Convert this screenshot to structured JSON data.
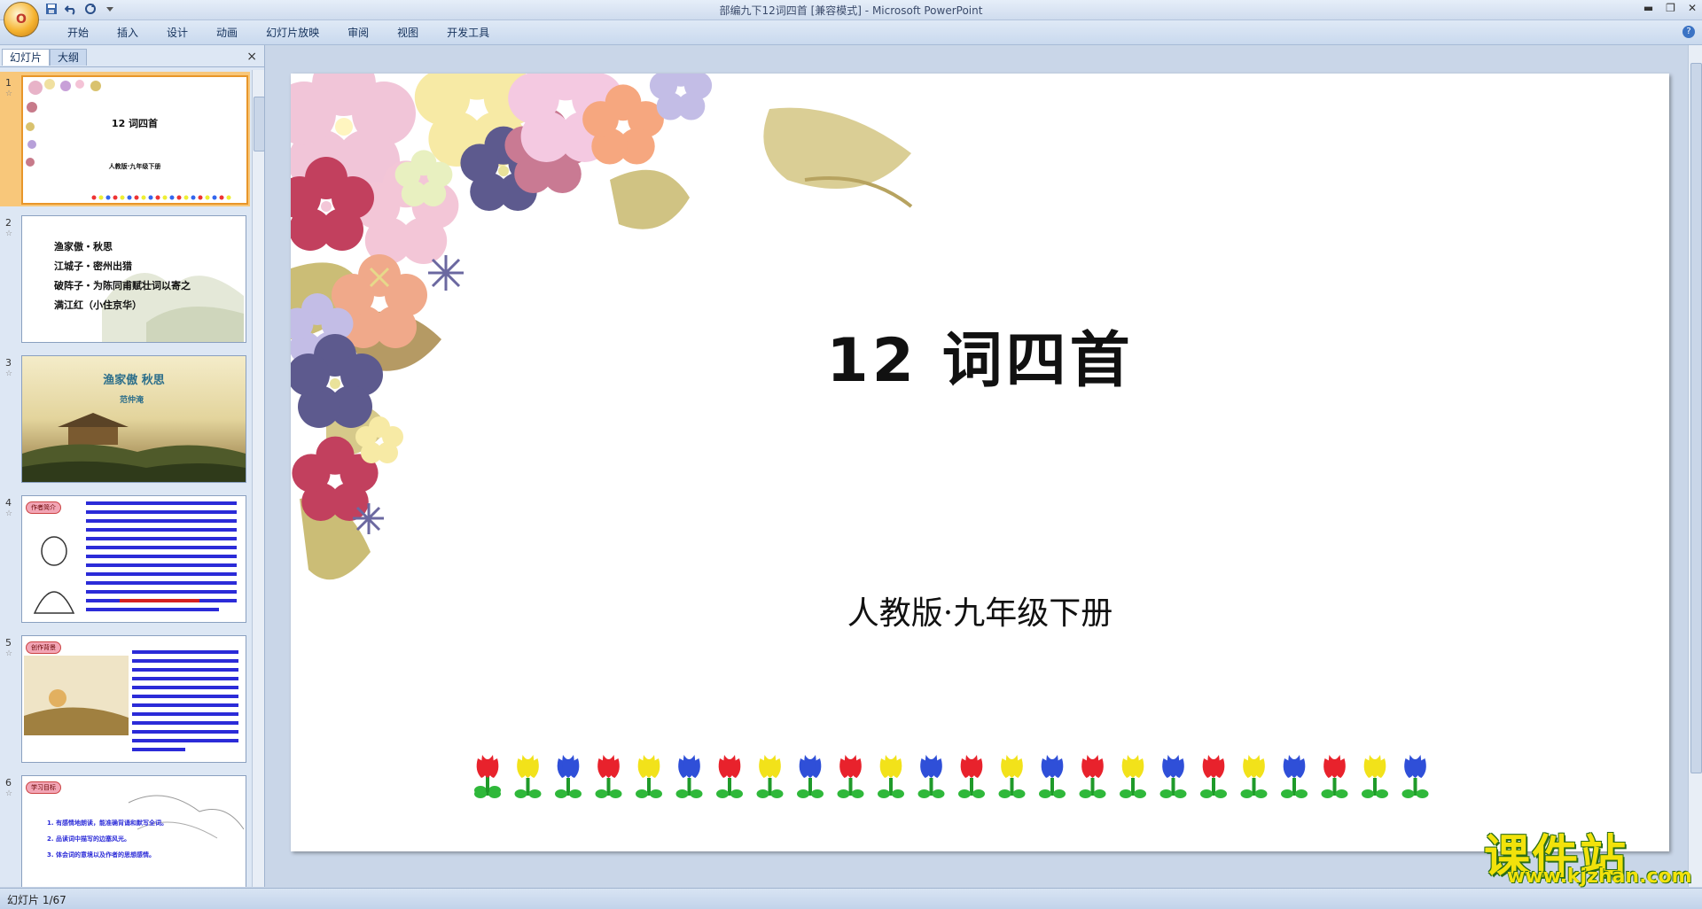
{
  "window": {
    "title": "部编九下12词四首 [兼容模式] - Microsoft PowerPoint",
    "office_button_label": "O",
    "qat_icons": [
      "save-icon",
      "undo-icon",
      "redo-icon",
      "customize-icon"
    ]
  },
  "ribbon": {
    "tabs": [
      "开始",
      "插入",
      "设计",
      "动画",
      "幻灯片放映",
      "审阅",
      "视图",
      "开发工具"
    ],
    "help_label": "?"
  },
  "left_panel": {
    "tabs": [
      "幻灯片",
      "大纲"
    ],
    "close_label": "×",
    "thumbnails": [
      {
        "num": "1",
        "title": "12  词四首",
        "sub": "人教版·九年级下册"
      },
      {
        "num": "2",
        "lines": [
          "渔家傲・秋思",
          "江城子・密州出猎",
          "破阵子・为陈同甫赋壮词以寄之",
          "满江红（小住京华）"
        ]
      },
      {
        "num": "3",
        "title": "渔家傲  秋思",
        "sub": "范仲淹"
      },
      {
        "num": "4",
        "badge": "作者简介"
      },
      {
        "num": "5",
        "badge": "创作背景"
      },
      {
        "num": "6",
        "badge": "学习目标",
        "lines": [
          "1. 有感情地朗读，能准确背诵和默写全词。",
          "2. 品读词中描写的边塞风光。",
          "3. 体会词的意境以及作者的思想感情。"
        ]
      }
    ]
  },
  "slide": {
    "title": "12  词四首",
    "subtitle": "人教版·九年级下册"
  },
  "status": {
    "text": "幻灯片 1/67"
  },
  "watermark": {
    "cn": "课件站",
    "url": "www.kjzhan.com"
  }
}
